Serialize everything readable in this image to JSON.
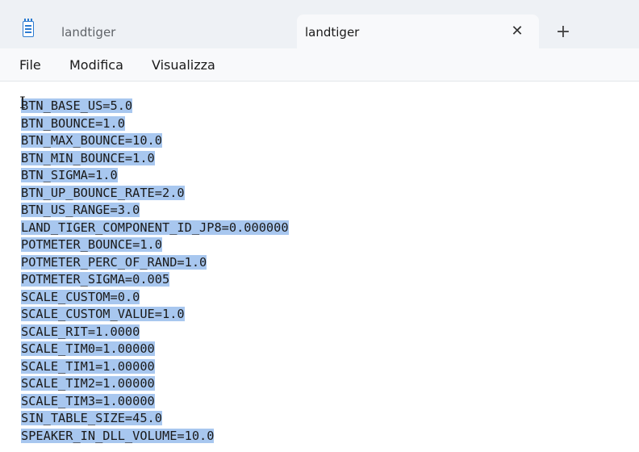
{
  "tabs": [
    {
      "label": "landtiger",
      "active": false
    },
    {
      "label": "landtiger",
      "active": true
    }
  ],
  "tab_close_glyph": "✕",
  "new_tab_glyph": "+",
  "menu": {
    "file": "File",
    "edit": "Modifica",
    "view": "Visualizza"
  },
  "selection_color": "#a8c7ef",
  "editor": {
    "lines": [
      "BTN_BASE_US=5.0",
      "BTN_BOUNCE=1.0",
      "BTN_MAX_BOUNCE=10.0",
      "BTN_MIN_BOUNCE=1.0",
      "BTN_SIGMA=1.0",
      "BTN_UP_BOUNCE_RATE=2.0",
      "BTN_US_RANGE=3.0",
      "LAND_TIGER_COMPONENT_ID_JP8=0.000000",
      "POTMETER_BOUNCE=1.0",
      "POTMETER_PERC_OF_RAND=1.0",
      "POTMETER_SIGMA=0.005",
      "SCALE_CUSTOM=0.0",
      "SCALE_CUSTOM_VALUE=1.0",
      "SCALE_RIT=1.0000",
      "SCALE_TIM0=1.00000",
      "SCALE_TIM1=1.00000",
      "SCALE_TIM2=1.00000",
      "SCALE_TIM3=1.00000",
      "SIN_TABLE_SIZE=45.0",
      "SPEAKER_IN_DLL_VOLUME=10.0"
    ]
  }
}
